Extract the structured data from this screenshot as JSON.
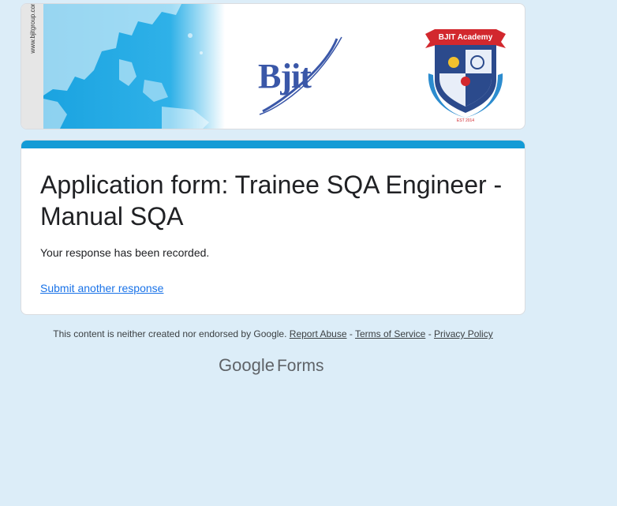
{
  "banner": {
    "side_url": "www.bjitgroup.com",
    "brand_logo_text": "Bjit",
    "academy_name": "BJIT Academy",
    "academy_est": "EST 2014"
  },
  "form": {
    "title": "Application form: Trainee SQA Engineer - Manual SQA",
    "confirmation": "Your response has been recorded.",
    "submit_another_label": "Submit another response"
  },
  "footer": {
    "disclaimer": "This content is neither created nor endorsed by Google.",
    "report_abuse": "Report Abuse",
    "separator": "-",
    "terms": "Terms of Service",
    "privacy": "Privacy Policy",
    "brand_google": "Google",
    "brand_forms": "Forms"
  },
  "colors": {
    "page_background": "#dcedf8",
    "accent_bar": "#139bd6",
    "link": "#1a73e8",
    "brand_blue": "#3a57a8"
  }
}
